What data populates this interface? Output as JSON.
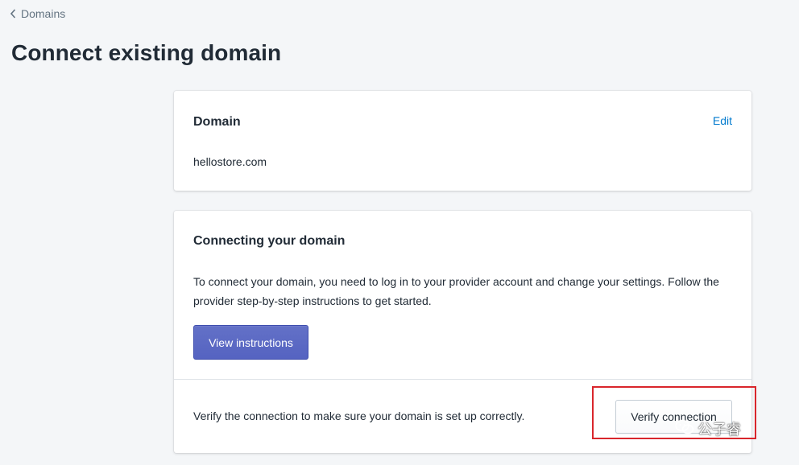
{
  "breadcrumb": {
    "label": "Domains"
  },
  "page": {
    "title": "Connect existing domain"
  },
  "domain_card": {
    "heading": "Domain",
    "edit_label": "Edit",
    "domain": "hellostore.com"
  },
  "connect_card": {
    "heading": "Connecting your domain",
    "description": "To connect your domain, you need to log in to your provider account and change your settings. Follow the provider step-by-step instructions to get started.",
    "view_instructions_label": "View instructions",
    "verify_text": "Verify the connection to make sure your domain is set up correctly.",
    "verify_button_label": "Verify connection"
  },
  "watermark": {
    "text": "公子睿"
  },
  "icons": {
    "back": "chevron-left-icon",
    "wechat": "wechat-icon"
  },
  "colors": {
    "primary": "#5c6ac4",
    "link": "#007ace",
    "highlight": "#d9262c",
    "background": "#f4f6f8"
  }
}
